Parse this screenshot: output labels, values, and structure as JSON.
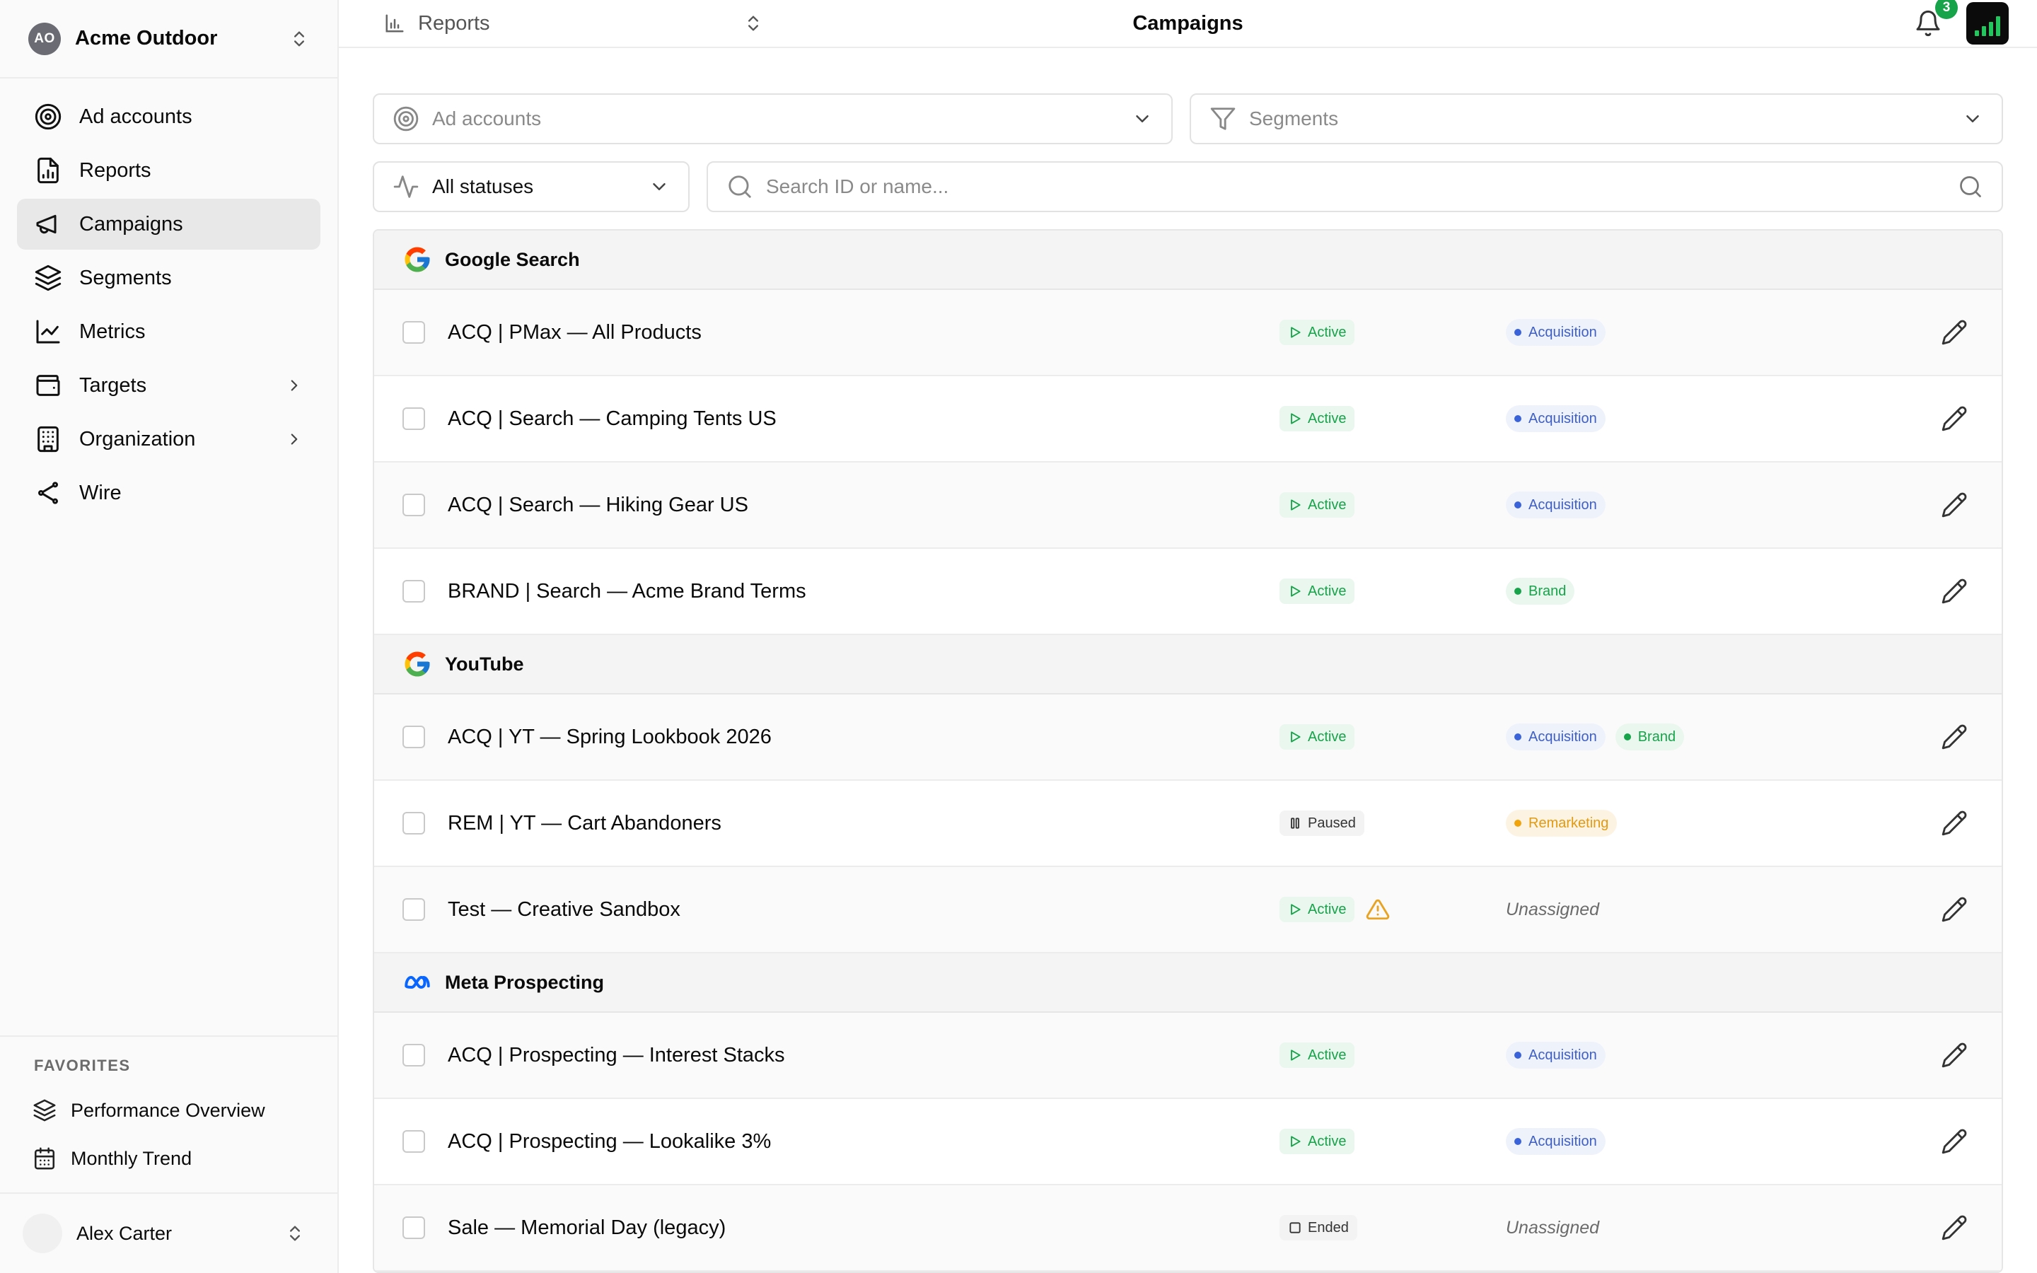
{
  "org": {
    "initials": "AO",
    "name": "Acme Outdoor"
  },
  "nav": [
    {
      "id": "ad-accounts",
      "label": "Ad accounts",
      "icon": "target-icon"
    },
    {
      "id": "reports",
      "label": "Reports",
      "icon": "file-chart-icon"
    },
    {
      "id": "campaigns",
      "label": "Campaigns",
      "icon": "megaphone-icon",
      "active": true
    },
    {
      "id": "segments",
      "label": "Segments",
      "icon": "layers-icon"
    },
    {
      "id": "metrics",
      "label": "Metrics",
      "icon": "line-chart-icon"
    },
    {
      "id": "targets",
      "label": "Targets",
      "icon": "wallet-icon",
      "expandable": true
    },
    {
      "id": "organization",
      "label": "Organization",
      "icon": "building-icon",
      "expandable": true
    },
    {
      "id": "wire",
      "label": "Wire",
      "icon": "share-icon"
    }
  ],
  "favorites": {
    "title": "FAVORITES",
    "items": [
      {
        "label": "Performance Overview",
        "icon": "layers-icon"
      },
      {
        "label": "Monthly Trend",
        "icon": "calendar-icon"
      }
    ]
  },
  "user": {
    "name": "Alex Carter"
  },
  "topbar": {
    "report_label": "Reports",
    "title": "Campaigns",
    "notifications": "3"
  },
  "filters": {
    "ad_accounts_placeholder": "Ad accounts",
    "segments_placeholder": "Segments",
    "status_value": "All statuses",
    "search_placeholder": "Search ID or name..."
  },
  "colors": {
    "active": "#17a34a",
    "acquisition": "#3b63d9",
    "brand": "#16a34a",
    "remarketing": "#f0a30a",
    "badge": "#16a34a"
  },
  "groups": [
    {
      "name": "Google Search",
      "logo": "google-icon",
      "rows": [
        {
          "name": "ACQ | PMax — All Products",
          "status": "Active",
          "status_type": "active",
          "segments": [
            {
              "label": "Acquisition",
              "type": "acq"
            }
          ]
        },
        {
          "name": "ACQ | Search — Camping Tents US",
          "status": "Active",
          "status_type": "active",
          "segments": [
            {
              "label": "Acquisition",
              "type": "acq"
            }
          ]
        },
        {
          "name": "ACQ | Search — Hiking Gear US",
          "status": "Active",
          "status_type": "active",
          "segments": [
            {
              "label": "Acquisition",
              "type": "acq"
            }
          ]
        },
        {
          "name": "BRAND | Search — Acme Brand Terms",
          "status": "Active",
          "status_type": "active",
          "segments": [
            {
              "label": "Brand",
              "type": "brand"
            }
          ]
        }
      ]
    },
    {
      "name": "YouTube",
      "logo": "google-icon",
      "rows": [
        {
          "name": "ACQ | YT — Spring Lookbook 2026",
          "status": "Active",
          "status_type": "active",
          "segments": [
            {
              "label": "Acquisition",
              "type": "acq"
            },
            {
              "label": "Brand",
              "type": "brand"
            }
          ]
        },
        {
          "name": "REM | YT — Cart Abandoners",
          "status": "Paused",
          "status_type": "paused",
          "segments": [
            {
              "label": "Remarketing",
              "type": "rem"
            }
          ]
        },
        {
          "name": "Test — Creative Sandbox",
          "status": "Active",
          "status_type": "active",
          "warning": true,
          "segments": [],
          "unassigned": "Unassigned"
        }
      ]
    },
    {
      "name": "Meta Prospecting",
      "logo": "meta-icon",
      "rows": [
        {
          "name": "ACQ | Prospecting — Interest Stacks",
          "status": "Active",
          "status_type": "active",
          "segments": [
            {
              "label": "Acquisition",
              "type": "acq"
            }
          ]
        },
        {
          "name": "ACQ | Prospecting — Lookalike 3%",
          "status": "Active",
          "status_type": "active",
          "segments": [
            {
              "label": "Acquisition",
              "type": "acq"
            }
          ]
        },
        {
          "name": "Sale — Memorial Day (legacy)",
          "status": "Ended",
          "status_type": "ended",
          "segments": [],
          "unassigned": "Unassigned"
        }
      ]
    }
  ]
}
